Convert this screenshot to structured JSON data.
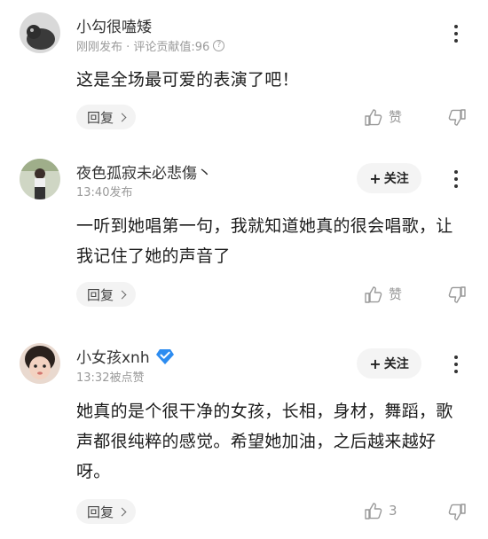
{
  "comments": [
    {
      "username": "小勾很嗑矮",
      "meta_text": "刚刚发布 · 评论贡献值:96",
      "info_icon": "?",
      "text": "这是全场最可爱的表演了吧！",
      "reply_label": "回复",
      "like_label": "赞",
      "show_follow": false
    },
    {
      "username": "夜色孤寂未必悲傷丶",
      "meta_text": "13:40发布",
      "text": "一听到她唱第一句，我就知道她真的很会唱歌，让我记住了她的声音了",
      "reply_label": "回复",
      "like_label": "赞",
      "follow_label": "关注",
      "show_follow": true
    },
    {
      "username": "小女孩xnh",
      "meta_text": "13:32被点赞",
      "text": "她真的是个很干净的女孩，长相，身材，舞蹈，歌声都很纯粹的感觉。希望她加油，之后越来越好呀。",
      "reply_label": "回复",
      "like_label": "3",
      "follow_label": "关注",
      "show_follow": true,
      "verified_icon": "verified-diamond-icon"
    }
  ],
  "colors": {
    "accent_verified": "#2d8cf0",
    "meta_gray": "#9a9a9a",
    "button_bg": "#f3f3f3"
  }
}
